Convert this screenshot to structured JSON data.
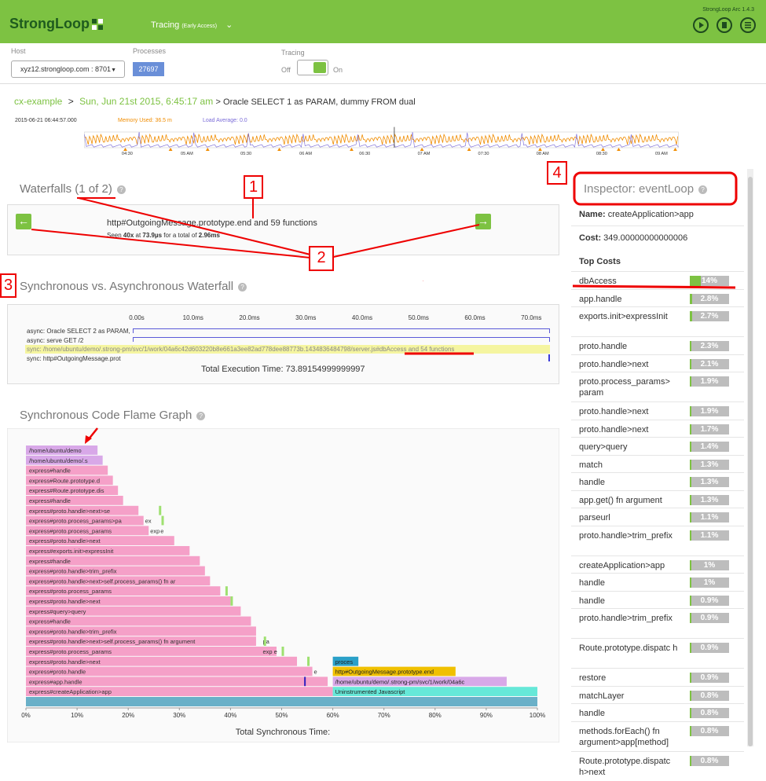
{
  "header": {
    "logo": "StrongLoop",
    "module": "Tracing",
    "module_note": "(Early Access)",
    "version": "StrongLoop Arc 1.4.3",
    "icons": [
      "play-icon",
      "document-icon",
      "menu-icon"
    ]
  },
  "controls": {
    "host_label": "Host",
    "host_value": "xyz12.strongloop.com : 8701",
    "processes_label": "Processes",
    "process_id": "27697",
    "tracing_label": "Tracing",
    "off_label": "Off",
    "on_label": "On",
    "tracing_on": true
  },
  "breadcrumb": {
    "app": "cx-example",
    "sep": ">",
    "date": "Sun, Jun 21st 2015, 6:45:17 am",
    "query": "> Oracle SELECT 1 as PARAM, dummy FROM dual"
  },
  "timeline": {
    "timestamp": "2015-06-21 06:44:57.000",
    "memory": "Memory Used: 36.5 m",
    "load": "Load Average: 0.0",
    "ticks": [
      "04:30",
      "05 AM",
      "05:30",
      "06 AM",
      "06:30",
      "07 AM",
      "07:30",
      "08 AM",
      "08:30",
      "09 AM"
    ],
    "colors": {
      "memory": "#f08c00",
      "load": "#7b6cd8"
    }
  },
  "waterfalls": {
    "title": "Waterfalls",
    "counter": "(1 of 2)",
    "function_name": "http#OutgoingMessage.prototype.end and 59 functions",
    "seen_prefix": "Seen",
    "seen_count": "40x",
    "seen_at": "at",
    "seen_time": "73.9µs",
    "seen_total_label": "for a total of",
    "seen_total": "2.96ms"
  },
  "sync_async": {
    "title": "Synchronous vs. Asynchronous Waterfall",
    "axis": [
      "0.00s",
      "10.0ms",
      "20.0ms",
      "30.0ms",
      "40.0ms",
      "50.0ms",
      "60.0ms",
      "70.0ms"
    ],
    "rows": [
      "async: Oracle SELECT 2 as PARAM,",
      "async: serve GET /2",
      "sync: /home/ubuntu/demo/.strong-pm/svc/1/work/04a6c42d603220b8e661a3ee82ad778dee88773b.1434836484798/server.js#dbAccess and 54 functions",
      "sync: http#OutgoingMessage.prot"
    ],
    "total": "Total Execution Time: 73.89154999999997"
  },
  "flame": {
    "title": "Synchronous Code Flame Graph",
    "axis": [
      "0%",
      "10%",
      "20%",
      "30%",
      "40%",
      "50%",
      "60%",
      "70%",
      "80%",
      "90%",
      "100%"
    ],
    "xlabel": "Total Synchronous Time:",
    "stack": [
      {
        "label": "/home/ubuntu/demo",
        "end": 14,
        "color": "#d8a8e8"
      },
      {
        "label": "/home/ubuntu/demo/.s",
        "end": 15,
        "color": "#d8a8e8"
      },
      {
        "label": "express#handle",
        "end": 16,
        "color": "#f5a0c8"
      },
      {
        "label": "express#Route.prototype.d",
        "end": 17,
        "color": "#f5a0c8"
      },
      {
        "label": "express#Route.prototype.dis",
        "end": 18,
        "color": "#f5a0c8"
      },
      {
        "label": "express#handle",
        "end": 19,
        "color": "#f5a0c8"
      },
      {
        "label": "express#proto.handle>next>se",
        "end": 22,
        "color": "#f5a0c8"
      },
      {
        "label": "express#proto.process_params>pa",
        "end": 23,
        "color": "#f5a0c8"
      },
      {
        "label": "express#proto.process_params",
        "end": 24,
        "color": "#f5a0c8"
      },
      {
        "label": "express#proto.handle>next",
        "end": 29,
        "color": "#f5a0c8"
      },
      {
        "label": "express#exports.init>expressInit",
        "end": 32,
        "color": "#f5a0c8"
      },
      {
        "label": "express#handle",
        "end": 34,
        "color": "#f5a0c8"
      },
      {
        "label": "express#proto.handle>trim_prefix",
        "end": 35,
        "color": "#f5a0c8"
      },
      {
        "label": "express#proto.handle>next>self.process_params() fn ar",
        "end": 36,
        "color": "#f5a0c8"
      },
      {
        "label": "express#proto.process_params",
        "end": 38,
        "color": "#f5a0c8"
      },
      {
        "label": "express#proto.handle>next",
        "end": 40,
        "color": "#f5a0c8"
      },
      {
        "label": "express#query>query",
        "end": 42,
        "color": "#f5a0c8"
      },
      {
        "label": "express#handle",
        "end": 44,
        "color": "#f5a0c8"
      },
      {
        "label": "express#proto.handle>trim_prefix",
        "end": 45,
        "color": "#f5a0c8"
      },
      {
        "label": "express#proto.handle>next>self.process_params() fn argument",
        "end": 45,
        "color": "#f5a0c8"
      },
      {
        "label": "express#proto.process_params",
        "end": 49,
        "color": "#f5a0c8"
      },
      {
        "label": "express#proto.handle>next",
        "end": 53,
        "color": "#f5a0c8"
      },
      {
        "label": "express#proto.handle",
        "end": 56,
        "color": "#f5a0c8"
      },
      {
        "label": "express#app.handle",
        "end": 59,
        "color": "#f5a0c8"
      },
      {
        "label": "express#createApplication>app",
        "end": 60,
        "color": "#f5a0c8"
      }
    ],
    "side_blocks": [
      {
        "label": "proces",
        "start": 60,
        "end": 65,
        "row": 21,
        "color": "#2aa0c8"
      },
      {
        "label": "http#OutgoingMessage.prototype.end",
        "start": 60,
        "end": 84,
        "row": 22,
        "color": "#f0c000"
      },
      {
        "label": "/home/ubuntu/demo/.strong-pm/svc/1/work/04a6c",
        "start": 60,
        "end": 94,
        "row": 23,
        "color": "#d8a8e8"
      },
      {
        "label": "Uninstrumented Javascript",
        "start": 60,
        "end": 100,
        "row": 24,
        "color": "#66e8d8"
      }
    ],
    "small_labels": [
      {
        "label": "ex",
        "row": 7,
        "pos": 23
      },
      {
        "label": "exp",
        "row": 8,
        "pos": 24
      },
      {
        "label": "e",
        "row": 8,
        "pos": 26
      },
      {
        "label": "pa",
        "row": 19,
        "pos": 46
      },
      {
        "label": "exp e",
        "row": 20,
        "pos": 46
      },
      {
        "label": "e",
        "row": 22,
        "pos": 56
      }
    ],
    "root_color": "#6ab0c8"
  },
  "inspector": {
    "title": "Inspector: eventLoop",
    "name_label": "Name:",
    "name_value": "createApplication>app",
    "cost_label": "Cost:",
    "cost_value": "349.00000000000006",
    "top_costs_label": "Top Costs",
    "costs": [
      {
        "name": "dbAccess",
        "pct": "14%",
        "fill": 0.14
      },
      {
        "name": "app.handle",
        "pct": "2.8%",
        "fill": 0.028
      },
      {
        "name": "exports.init>expressInit",
        "pct": "2.7%",
        "fill": 0.027
      },
      {
        "name": "proto.handle",
        "pct": "2.3%",
        "fill": 0.023
      },
      {
        "name": "proto.handle>next",
        "pct": "2.1%",
        "fill": 0.021
      },
      {
        "name": "proto.process_params> param",
        "pct": "1.9%",
        "fill": 0.019
      },
      {
        "name": "proto.handle>next",
        "pct": "1.9%",
        "fill": 0.019
      },
      {
        "name": "proto.handle>next",
        "pct": "1.7%",
        "fill": 0.017
      },
      {
        "name": "query>query",
        "pct": "1.4%",
        "fill": 0.014
      },
      {
        "name": "match",
        "pct": "1.3%",
        "fill": 0.013
      },
      {
        "name": "handle",
        "pct": "1.3%",
        "fill": 0.013
      },
      {
        "name": "app.get() fn argument",
        "pct": "1.3%",
        "fill": 0.013
      },
      {
        "name": "parseurl",
        "pct": "1.1%",
        "fill": 0.011
      },
      {
        "name": "proto.handle>trim_prefix",
        "pct": "1.1%",
        "fill": 0.011
      },
      {
        "name": "createApplication>app",
        "pct": "1%",
        "fill": 0.01
      },
      {
        "name": "handle",
        "pct": "1%",
        "fill": 0.01
      },
      {
        "name": "handle",
        "pct": "0.9%",
        "fill": 0.009
      },
      {
        "name": "proto.handle>trim_prefix",
        "pct": "0.9%",
        "fill": 0.009
      },
      {
        "name": "Route.prototype.dispatc h",
        "pct": "0.9%",
        "fill": 0.009
      },
      {
        "name": "restore",
        "pct": "0.9%",
        "fill": 0.009
      },
      {
        "name": "matchLayer",
        "pct": "0.8%",
        "fill": 0.008
      },
      {
        "name": "handle",
        "pct": "0.8%",
        "fill": 0.008
      },
      {
        "name": "methods.forEach() fn argument>app[method]",
        "pct": "0.8%",
        "fill": 0.008
      },
      {
        "name": "Route.prototype.dispatc h>next",
        "pct": "0.8%",
        "fill": 0.008
      }
    ]
  },
  "annotations": [
    "1",
    "2",
    "3",
    "4"
  ]
}
